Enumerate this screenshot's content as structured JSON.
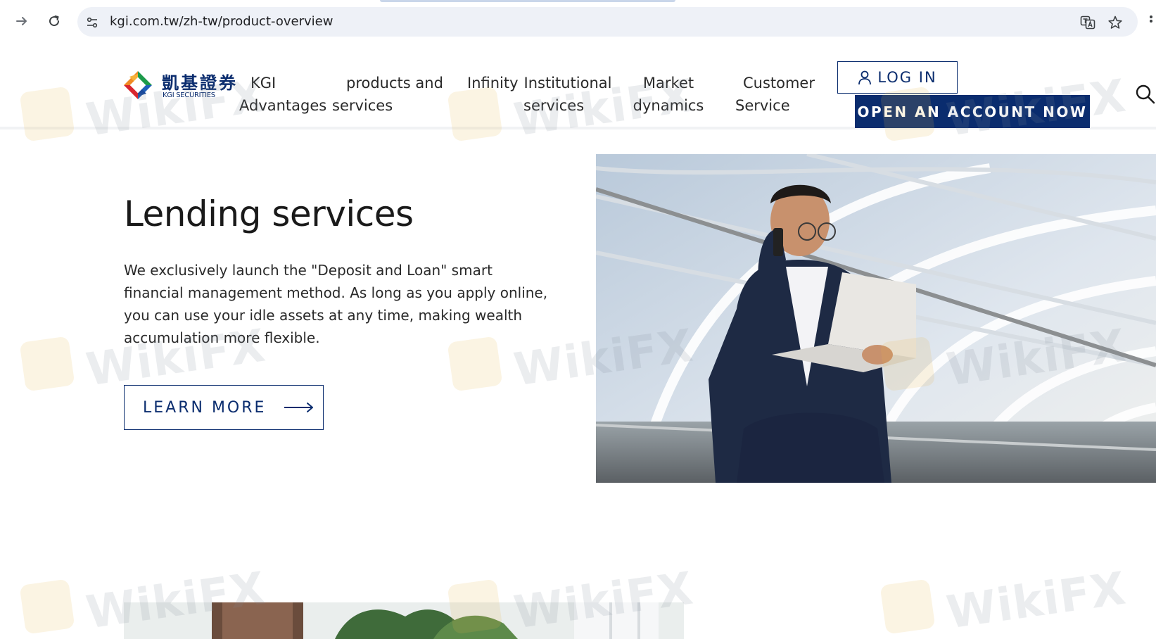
{
  "browser": {
    "url": "kgi.com.tw/zh-tw/product-overview"
  },
  "header": {
    "logo_cn": "凱基證券",
    "logo_en": "KGI SECURITIES",
    "nav": [
      {
        "line1": "KGI",
        "line2": "Advantages"
      },
      {
        "line1": "products and",
        "line2": "services"
      },
      {
        "line1": "Infinity",
        "line2": ""
      },
      {
        "line1": "Institutional",
        "line2": "services"
      },
      {
        "line1": "Market",
        "line2": "dynamics"
      },
      {
        "line1": "Customer",
        "line2": "Service"
      }
    ],
    "login_label": "LOG IN",
    "open_account_label": "OPEN AN ACCOUNT NOW"
  },
  "hero": {
    "title": "Lending services",
    "description": "We exclusively launch the \"Deposit and Loan\" smart financial management method. As long as you apply online, you can use your idle assets at any time, making wealth accumulation more flexible.",
    "cta_label": "LEARN MORE"
  },
  "watermark": {
    "text": "WikiFX"
  },
  "colors": {
    "brand_navy": "#0a2c6e",
    "logo_orange": "#f08a24",
    "logo_blue": "#1f5fb8",
    "logo_red": "#d8262f",
    "logo_green": "#1c9a4a"
  }
}
